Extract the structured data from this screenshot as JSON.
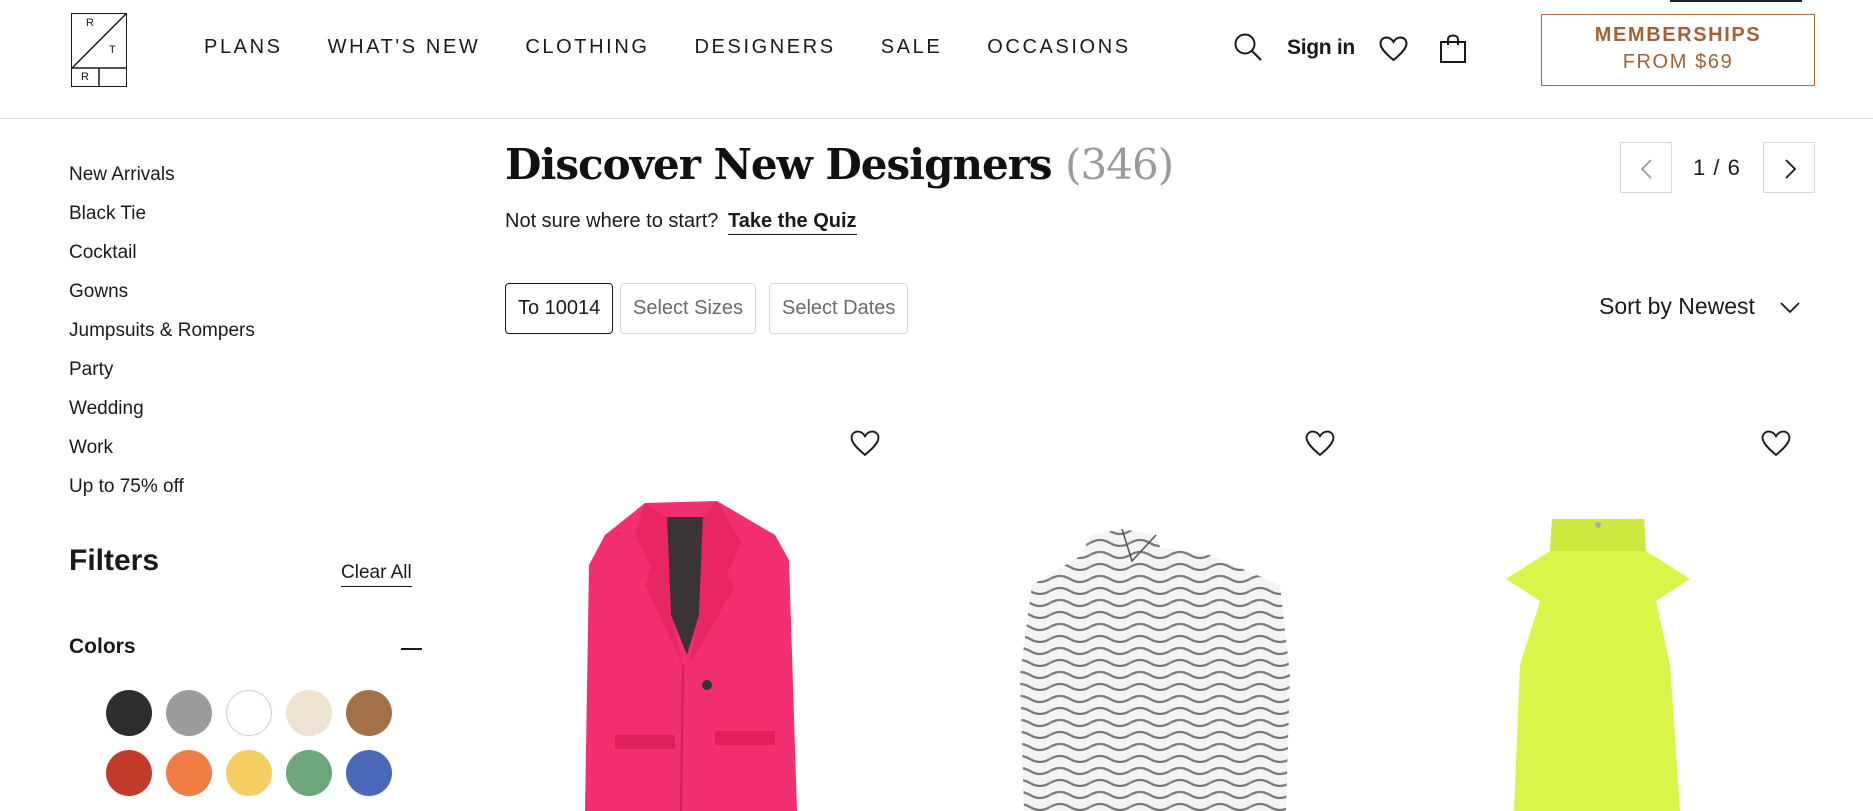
{
  "header": {
    "logo_letters": [
      "R",
      "T",
      "R"
    ],
    "nav": [
      "PLANS",
      "WHAT'S NEW",
      "CLOTHING",
      "DESIGNERS",
      "SALE",
      "OCCASIONS"
    ],
    "icons": [
      "search-icon",
      "heart-icon",
      "shopping-bag-icon"
    ],
    "sign_in": "Sign in",
    "membership_line1": "MEMBERSHIPS",
    "membership_line2": "FROM $69",
    "membership_color": "#a06335"
  },
  "sidebar": {
    "links": [
      "New Arrivals",
      "Black Tie",
      "Cocktail",
      "Gowns",
      "Jumpsuits & Rompers",
      "Party",
      "Wedding",
      "Work",
      "Up to 75% off"
    ],
    "filters_title": "Filters",
    "clear_all": "Clear All",
    "colors_label": "Colors",
    "swatches": [
      "#2e2e2e",
      "#9b9b9b",
      "#ffffff",
      "#eee3d1",
      "#a2714a",
      "#c23b2a",
      "#ef7d45",
      "#f6cd60",
      "#6ea67b",
      "#4a6ab9"
    ]
  },
  "main": {
    "title": "Discover New Designers",
    "count": "(346)",
    "quiz_prompt": "Not sure where to start?",
    "quiz_link": "Take the Quiz",
    "pager": "1 / 6",
    "chips": [
      "To 10014",
      "Select Sizes",
      "Select Dates"
    ],
    "sort_label": "Sort by Newest",
    "products": [
      {
        "name": "pink velvet blazer",
        "color": "#f2306f"
      },
      {
        "name": "black and white swirl print top",
        "color": "#d9d9d9"
      },
      {
        "name": "neon yellow halter top",
        "color": "#d8f54a"
      }
    ]
  }
}
